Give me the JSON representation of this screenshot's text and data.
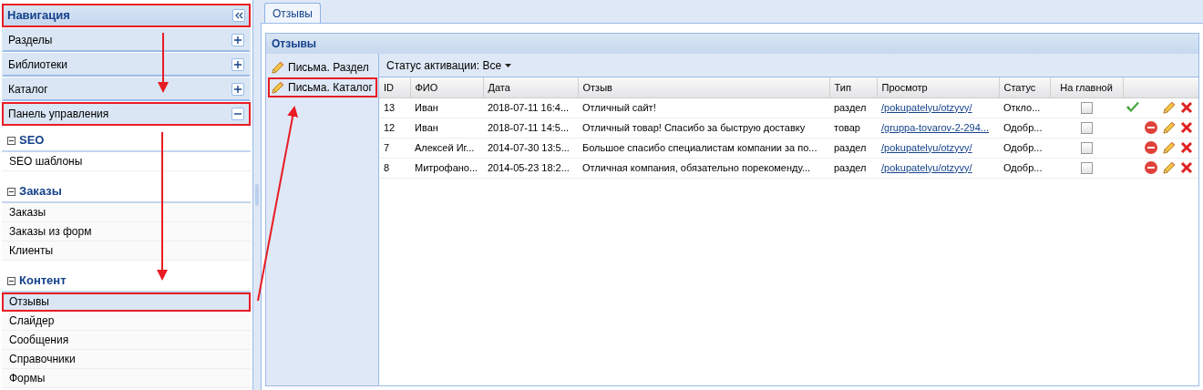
{
  "navigation": {
    "title": "Навигация",
    "highlighted": true,
    "sections": [
      {
        "label": "Разделы",
        "expanded": false,
        "highlighted": false
      },
      {
        "label": "Библиотеки",
        "expanded": false,
        "highlighted": false
      },
      {
        "label": "Каталог",
        "expanded": false,
        "highlighted": false
      },
      {
        "label": "Панель управления",
        "expanded": true,
        "highlighted": true
      }
    ],
    "groups": [
      {
        "title": "SEO",
        "expanded": true,
        "items": [
          {
            "label": "SEO шаблоны",
            "highlighted": false
          }
        ]
      },
      {
        "title": "Заказы",
        "expanded": true,
        "items": [
          {
            "label": "Заказы",
            "highlighted": false
          },
          {
            "label": "Заказы из форм",
            "highlighted": false
          },
          {
            "label": "Клиенты",
            "highlighted": false
          }
        ]
      },
      {
        "title": "Контент",
        "expanded": true,
        "items": [
          {
            "label": "Отзывы",
            "highlighted": true
          },
          {
            "label": "Слайдер",
            "highlighted": false
          },
          {
            "label": "Сообщения",
            "highlighted": false
          },
          {
            "label": "Справочники",
            "highlighted": false
          },
          {
            "label": "Формы",
            "highlighted": false
          }
        ]
      }
    ]
  },
  "tabs": [
    {
      "label": "Отзывы",
      "selected": true
    }
  ],
  "panel": {
    "title": "Отзывы",
    "side_items": [
      {
        "label": "Письма. Раздел",
        "highlighted": false
      },
      {
        "label": "Письма. Каталог",
        "highlighted": true
      }
    ],
    "filter": {
      "label": "Статус активации:",
      "value": "Все"
    },
    "table": {
      "columns": [
        "ID",
        "ФИО",
        "Дата",
        "Отзыв",
        "Тип",
        "Просмотр",
        "Статус",
        "На главной"
      ],
      "rows": [
        {
          "cells": [
            "13",
            "Иван",
            "2018-07-11 16:4...",
            "Отличный сайт!",
            "раздел",
            "/pokupatelyu/otzyvy/",
            "Откло..."
          ],
          "on_main": false,
          "approved": false
        },
        {
          "cells": [
            "12",
            "Иван",
            "2018-07-11 14:5...",
            "Отличный товар! Спасибо за быструю доставку",
            "товар",
            "/gruppa-tovarov-2-294...",
            "Одобр..."
          ],
          "on_main": false,
          "approved": true
        },
        {
          "cells": [
            "7",
            "Алексей Иг...",
            "2014-07-30 13:5...",
            "Большое спасибо специалистам компании за по...",
            "раздел",
            "/pokupatelyu/otzyvy/",
            "Одобр..."
          ],
          "on_main": false,
          "approved": true
        },
        {
          "cells": [
            "8",
            "Митрофано...",
            "2014-05-23 18:2...",
            "Отличная компания, обязательно порекоменду...",
            "раздел",
            "/pokupatelyu/otzyvy/",
            "Одобр..."
          ],
          "on_main": false,
          "approved": true
        }
      ]
    }
  }
}
